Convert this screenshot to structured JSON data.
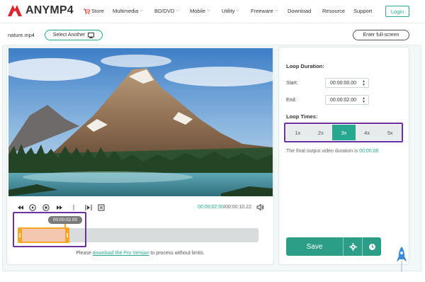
{
  "brand": {
    "name": "ANYMP4",
    "accent": "#27a88f",
    "logo_red": "#d9272e"
  },
  "nav": {
    "items": [
      {
        "label": "Store",
        "icon": "cart-icon",
        "dropdown": false
      },
      {
        "label": "Multimedia",
        "dropdown": true
      },
      {
        "label": "BD/DVD",
        "dropdown": true
      },
      {
        "label": "Mobile",
        "dropdown": true
      },
      {
        "label": "Utility",
        "dropdown": true
      },
      {
        "label": "Freeware",
        "dropdown": true
      },
      {
        "label": "Download",
        "dropdown": false
      },
      {
        "label": "Resource",
        "dropdown": false
      },
      {
        "label": "Support",
        "dropdown": false
      }
    ],
    "login_label": "Login",
    "chevron": "⌵"
  },
  "toolbar": {
    "filename": "nature.mp4",
    "select_another_label": "Select Another",
    "fullscreen_label": "Enter full-screen"
  },
  "player": {
    "current_time": "00:00:02.00",
    "total_time": "/00:00:10.22",
    "marker_time": "00:00:02.00",
    "selection_fraction": 0.2
  },
  "pro_note": {
    "before": "Please ",
    "link": "download the Pro Version",
    "after": " to process without limits."
  },
  "settings": {
    "loop_duration_title": "Loop Duration:",
    "start_label": "Start:",
    "start_value": "00:00:00.00",
    "end_label": "End:",
    "end_value": "00:00:02.00",
    "loop_times_title": "Loop Times:",
    "loop_options": [
      "1x",
      "2x",
      "3x",
      "4x",
      "5x"
    ],
    "selected_loop": "3x",
    "output_prefix": "The final output video duration is ",
    "output_duration": "00:00:06",
    "save_label": "Save"
  },
  "highlight_color": "#6b2fa6"
}
